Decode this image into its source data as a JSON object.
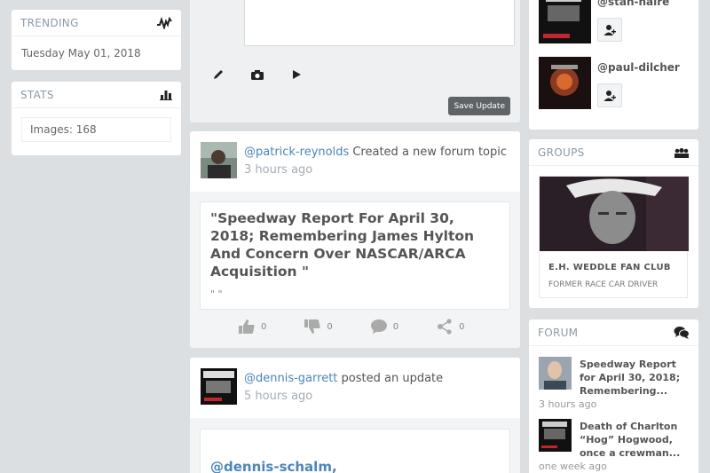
{
  "trending": {
    "heading": "TRENDING",
    "date": "Tuesday May 01, 2018"
  },
  "stats": {
    "heading": "STATS",
    "images_label": "Images: 168"
  },
  "composer": {
    "save_label": "Save Update",
    "tools": [
      "pencil-icon",
      "camera-icon",
      "play-icon"
    ]
  },
  "feed": [
    {
      "user": "@patrick-reynolds",
      "action": "Created a new forum topic",
      "time": "3 hours ago",
      "title": "\"Speedway Report For April 30, 2018; Remembering James Hylton And Concern Over NASCAR/ARCA Acquisition \"",
      "quote": "\" \"",
      "likes": "0",
      "dislikes": "0",
      "comments": "0",
      "shares": "0"
    },
    {
      "user": "@dennis-garrett",
      "action": "posted an update",
      "time": "5 hours ago",
      "mention": "@dennis-schalm,"
    }
  ],
  "follow": {
    "users": [
      {
        "handle": "@stan-haire"
      },
      {
        "handle": "@paul-dilcher"
      }
    ]
  },
  "groups": {
    "heading": "GROUPS",
    "items": [
      {
        "name": "E.H. WEDDLE FAN CLUB",
        "description": "FORMER RACE CAR DRIVER"
      }
    ]
  },
  "forum": {
    "heading": "FORUM",
    "items": [
      {
        "title": "Speedway Report for April 30, 2018; Remembering...",
        "time": "3 hours ago"
      },
      {
        "title": "Death of Charlton “Hog” Hogwood, once a crewman...",
        "time": "one week ago"
      }
    ]
  },
  "colors": {
    "link": "#4a86b8",
    "page_bg": "#dcdfe2",
    "muted_heading": "#8a9aa8"
  }
}
